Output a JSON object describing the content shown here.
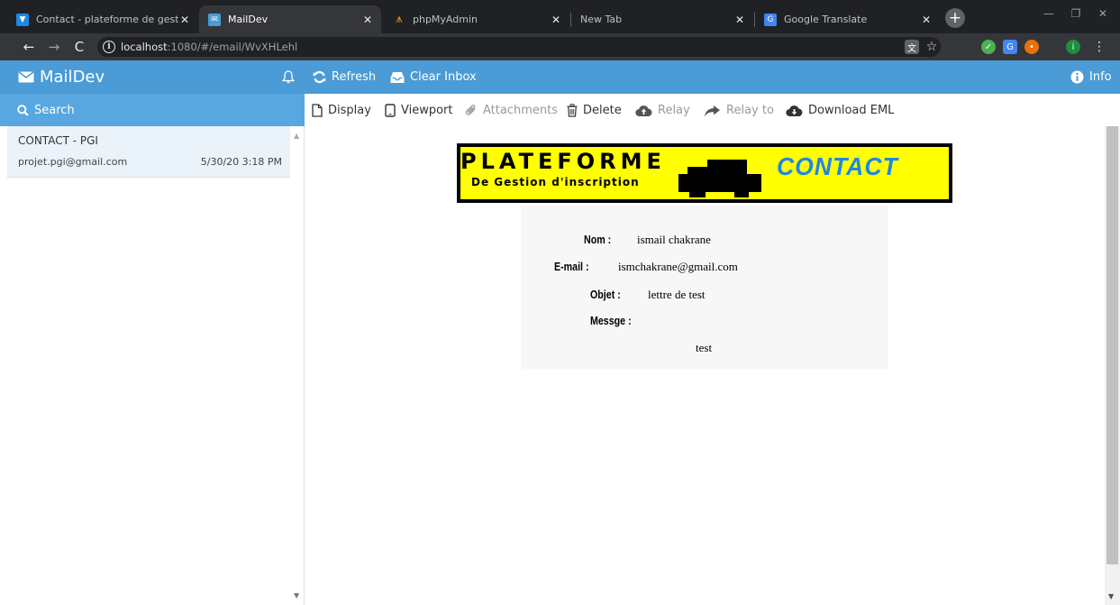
{
  "browser": {
    "tabs": [
      {
        "title": "Contact - plateforme de gestio",
        "active": false,
        "favicon": "plateforme-icon"
      },
      {
        "title": "MailDev",
        "active": true,
        "favicon": "maildev-envelope-icon"
      },
      {
        "title": "phpMyAdmin",
        "active": false,
        "favicon": "phpmyadmin-icon"
      },
      {
        "title": "New Tab",
        "active": false,
        "favicon": ""
      },
      {
        "title": "Google Translate",
        "active": false,
        "favicon": "google-translate-icon"
      }
    ],
    "url": {
      "host": "localhost",
      "rest": ":1080/#/email/WvXHLehl"
    },
    "profile_initial": "i"
  },
  "maildev": {
    "brand": "MailDev",
    "header": {
      "refresh": "Refresh",
      "clear_inbox": "Clear Inbox",
      "info": "Info"
    },
    "search_label": "Search",
    "emails": [
      {
        "subject": "CONTACT - PGI",
        "from": "projet.pgi@gmail.com",
        "date": "5/30/20 3:18 PM",
        "selected": true
      }
    ],
    "actions": {
      "display": "Display",
      "viewport": "Viewport",
      "attachments": "Attachments",
      "delete": "Delete",
      "relay": "Relay",
      "relay_to": "Relay to",
      "download_eml": "Download EML"
    }
  },
  "email_body": {
    "banner": {
      "title": "PLATEFORME",
      "subtitle": "De Gestion d'inscription",
      "contact": "CONTACT",
      "colors": {
        "background": "#ffff00",
        "border": "#000000",
        "contact": "#1e88e5"
      }
    },
    "fields": {
      "nom_label": "Nom :",
      "nom_value": "ismail chakrane",
      "email_label": "E-mail :",
      "email_value": "ismchakrane@gmail.com",
      "objet_label": "Objet :",
      "objet_value": "lettre de test",
      "message_label": "Messge :",
      "message_value": "test"
    }
  },
  "colors": {
    "maildev_header": "#4a9bd6",
    "search_bar": "#58a7e0",
    "selected_email": "#eaf2fa"
  }
}
